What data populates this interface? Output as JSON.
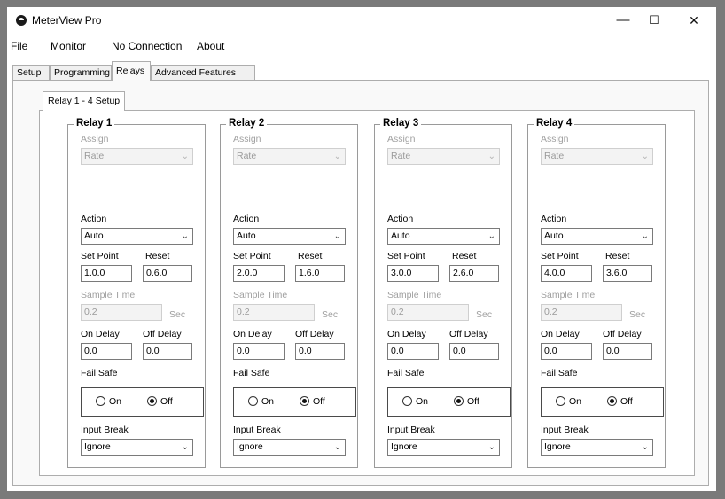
{
  "window": {
    "title": "MeterView Pro",
    "controls": {
      "minimize": "—",
      "maximize": "☐",
      "close": "✕"
    }
  },
  "menu": {
    "file": "File",
    "monitor": "Monitor",
    "connection": "No Connection",
    "about": "About"
  },
  "tabs": {
    "setup": "Setup",
    "programming": "Programming",
    "relays": "Relays",
    "advanced": "Advanced Features"
  },
  "subtab": "Relay 1 - 4 Setup",
  "relays": [
    {
      "title": "Relay 1",
      "assign_label": "Assign",
      "assign_value": "Rate",
      "action_label": "Action",
      "action_value": "Auto",
      "set_point_label": "Set Point",
      "set_point": "1.0.0",
      "reset_label": "Reset",
      "reset": "0.6.0",
      "sample_time_label": "Sample Time",
      "sample_time": "0.2",
      "sec_label": "Sec",
      "on_delay_label": "On Delay",
      "on_delay": "0.0",
      "off_delay_label": "Off Delay",
      "off_delay": "0.0",
      "fail_safe_label": "Fail Safe",
      "on_label": "On",
      "off_label": "Off",
      "fail_safe_selected": "Off",
      "input_break_label": "Input Break",
      "input_break_value": "Ignore"
    },
    {
      "title": "Relay 2",
      "assign_label": "Assign",
      "assign_value": "Rate",
      "action_label": "Action",
      "action_value": "Auto",
      "set_point_label": "Set Point",
      "set_point": "2.0.0",
      "reset_label": "Reset",
      "reset": "1.6.0",
      "sample_time_label": "Sample Time",
      "sample_time": "0.2",
      "sec_label": "Sec",
      "on_delay_label": "On Delay",
      "on_delay": "0.0",
      "off_delay_label": "Off Delay",
      "off_delay": "0.0",
      "fail_safe_label": "Fail Safe",
      "on_label": "On",
      "off_label": "Off",
      "fail_safe_selected": "Off",
      "input_break_label": "Input Break",
      "input_break_value": "Ignore"
    },
    {
      "title": "Relay 3",
      "assign_label": "Assign",
      "assign_value": "Rate",
      "action_label": "Action",
      "action_value": "Auto",
      "set_point_label": "Set Point",
      "set_point": "3.0.0",
      "reset_label": "Reset",
      "reset": "2.6.0",
      "sample_time_label": "Sample Time",
      "sample_time": "0.2",
      "sec_label": "Sec",
      "on_delay_label": "On Delay",
      "on_delay": "0.0",
      "off_delay_label": "Off Delay",
      "off_delay": "0.0",
      "fail_safe_label": "Fail Safe",
      "on_label": "On",
      "off_label": "Off",
      "fail_safe_selected": "Off",
      "input_break_label": "Input Break",
      "input_break_value": "Ignore"
    },
    {
      "title": "Relay 4",
      "assign_label": "Assign",
      "assign_value": "Rate",
      "action_label": "Action",
      "action_value": "Auto",
      "set_point_label": "Set Point",
      "set_point": "4.0.0",
      "reset_label": "Reset",
      "reset": "3.6.0",
      "sample_time_label": "Sample Time",
      "sample_time": "0.2",
      "sec_label": "Sec",
      "on_delay_label": "On Delay",
      "on_delay": "0.0",
      "off_delay_label": "Off Delay",
      "off_delay": "0.0",
      "fail_safe_label": "Fail Safe",
      "on_label": "On",
      "off_label": "Off",
      "fail_safe_selected": "Off",
      "input_break_label": "Input Break",
      "input_break_value": "Ignore"
    }
  ]
}
